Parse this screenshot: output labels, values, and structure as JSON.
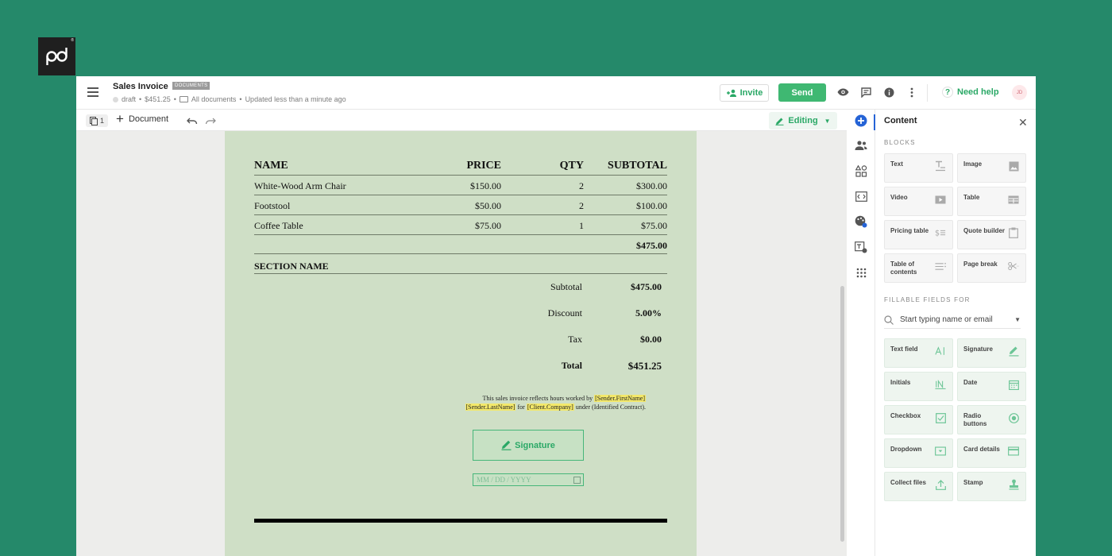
{
  "brand": {
    "logo_text": "pd",
    "reg": "®"
  },
  "header": {
    "title": "Sales Invoice",
    "badge": "DOCUMENTS",
    "status": "draft",
    "amount": "$451.25",
    "folder": "All documents",
    "updated": "Updated less than a minute ago",
    "invite_label": "Invite",
    "send_label": "Send",
    "help_label": "Need help",
    "avatar_initials": "JD"
  },
  "toolbar": {
    "pages_count": "1",
    "add_document_label": "Document",
    "editing_label": "Editing"
  },
  "invoice": {
    "columns": [
      "NAME",
      "PRICE",
      "QTY",
      "SUBTOTAL"
    ],
    "rows": [
      {
        "name": "White-Wood Arm Chair",
        "price": "$150.00",
        "qty": "2",
        "subtotal": "$300.00"
      },
      {
        "name": "Footstool",
        "price": "$50.00",
        "qty": "2",
        "subtotal": "$100.00"
      },
      {
        "name": "Coffee Table",
        "price": "$75.00",
        "qty": "1",
        "subtotal": "$75.00"
      }
    ],
    "table_total": "$475.00",
    "section_name": "SECTION NAME",
    "summary": {
      "subtotal_label": "Subtotal",
      "subtotal_value": "$475.00",
      "discount_label": "Discount",
      "discount_value": "5.00%",
      "tax_label": "Tax",
      "tax_value": "$0.00",
      "total_label": "Total",
      "total_value": "$451.25"
    },
    "note": {
      "text1": "This sales invoice reflects hours worked by",
      "tok1": "[Sender.FirstName]",
      "tok2": "[Sender.LastName]",
      "text2": "for",
      "tok3": "[Client.Company]",
      "text3": "under (Identified Contract)."
    },
    "signature_label": "Signature",
    "date_placeholder": "MM / DD / YYYY"
  },
  "panel": {
    "title": "Content",
    "blocks_heading": "BLOCKS",
    "blocks": [
      "Text",
      "Image",
      "Video",
      "Table",
      "Pricing table",
      "Quote builder",
      "Table of contents",
      "Page break"
    ],
    "fillable_heading": "FILLABLE FIELDS FOR",
    "search_placeholder": "Start typing name or email",
    "fields": [
      "Text field",
      "Signature",
      "Initials",
      "Date",
      "Checkbox",
      "Radio buttons",
      "Dropdown",
      "Card details",
      "Collect files",
      "Stamp"
    ]
  },
  "colors": {
    "background": "#25896a",
    "accent": "#3fb872",
    "paper": "#cfdfc6",
    "highlight": "#f3e86a"
  }
}
